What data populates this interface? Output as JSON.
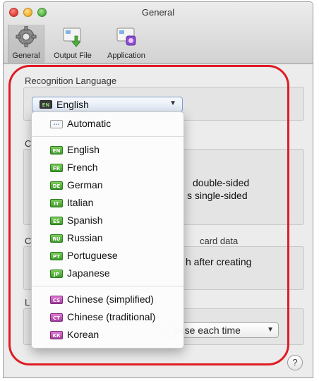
{
  "window": {
    "title": "General"
  },
  "toolbar": {
    "items": [
      {
        "label": "General",
        "selected": true
      },
      {
        "label": "Output File"
      },
      {
        "label": "Application"
      }
    ]
  },
  "recognition": {
    "section_label": "Recognition Language",
    "selected": "English",
    "selected_flag": "EN"
  },
  "background": {
    "sec2_prefix": "C",
    "sec2_line1": "double-sided",
    "sec2_line2": "s single-sided",
    "sec3_prefix": "C",
    "sec3_title": "card data",
    "sec3_line1": "h after creating",
    "sec4_prefix": "L",
    "select_value": "oose each time"
  },
  "menu": {
    "items": [
      {
        "label": "Automatic",
        "flag": "···",
        "kind": "auto"
      },
      {
        "separator": true
      },
      {
        "label": "English",
        "flag": "EN",
        "kind": "green"
      },
      {
        "label": "French",
        "flag": "FR",
        "kind": "green"
      },
      {
        "label": "German",
        "flag": "DE",
        "kind": "green"
      },
      {
        "label": "Italian",
        "flag": "IT",
        "kind": "green"
      },
      {
        "label": "Spanish",
        "flag": "ES",
        "kind": "green"
      },
      {
        "label": "Russian",
        "flag": "RU",
        "kind": "green"
      },
      {
        "label": "Portuguese",
        "flag": "PT",
        "kind": "green"
      },
      {
        "label": "Japanese",
        "flag": "JP",
        "kind": "green"
      },
      {
        "separator": true
      },
      {
        "label": "Chinese (simplified)",
        "flag": "CS",
        "kind": "magenta"
      },
      {
        "label": "Chinese (traditional)",
        "flag": "CT",
        "kind": "magenta"
      },
      {
        "label": "Korean",
        "flag": "KR",
        "kind": "magenta"
      }
    ]
  },
  "help": {
    "label": "?"
  },
  "colors": {
    "highlight_ring": "#e01b24",
    "accent": "#7ea0c9"
  }
}
